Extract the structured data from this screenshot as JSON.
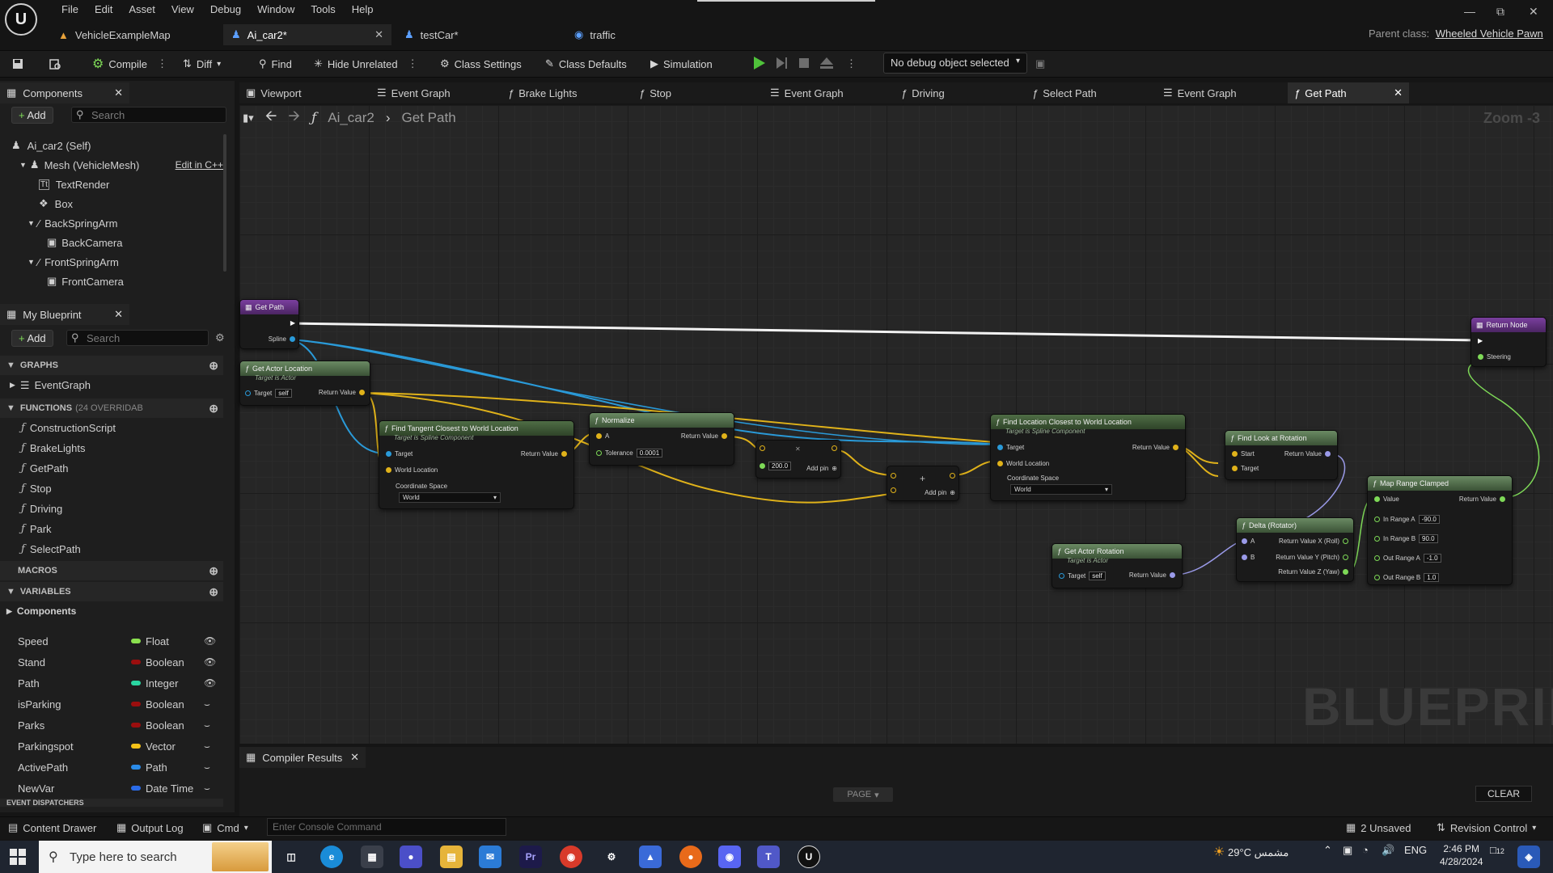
{
  "menu": [
    "File",
    "Edit",
    "Asset",
    "View",
    "Debug",
    "Window",
    "Tools",
    "Help"
  ],
  "doc_tabs": [
    {
      "label": "VehicleExampleMap",
      "icon": "map-icon",
      "active": false
    },
    {
      "label": "Ai_car2*",
      "icon": "pawn-icon",
      "active": true
    },
    {
      "label": "testCar*",
      "icon": "pawn-icon",
      "active": false
    },
    {
      "label": "traffic",
      "icon": "actor-icon",
      "active": false
    }
  ],
  "parent_class": {
    "label": "Parent class:",
    "value": "Wheeled Vehicle Pawn"
  },
  "toolbar": {
    "compile": "Compile",
    "diff": "Diff",
    "find": "Find",
    "hide_unrelated": "Hide Unrelated",
    "class_settings": "Class Settings",
    "class_defaults": "Class Defaults",
    "simulation": "Simulation",
    "debug_object": "No debug object selected"
  },
  "components": {
    "title": "Components",
    "add": "Add",
    "search_placeholder": "Search",
    "tree": [
      {
        "label": "Ai_car2 (Self)",
        "indent": 0
      },
      {
        "label": "Mesh (VehicleMesh)",
        "indent": 1,
        "extra": "Edit in C++"
      },
      {
        "label": "TextRender",
        "indent": 2
      },
      {
        "label": "Box",
        "indent": 2
      },
      {
        "label": "BackSpringArm",
        "indent": 2
      },
      {
        "label": "BackCamera",
        "indent": 3
      },
      {
        "label": "FrontSpringArm",
        "indent": 2
      },
      {
        "label": "FrontCamera",
        "indent": 3
      }
    ]
  },
  "my_blueprint": {
    "title": "My Blueprint",
    "add": "Add",
    "search_placeholder": "Search",
    "graphs_label": "GRAPHS",
    "graphs": [
      "EventGraph"
    ],
    "functions_label": "FUNCTIONS",
    "functions_note": "(24 OVERRIDAB",
    "functions": [
      "ConstructionScript",
      "BrakeLights",
      "GetPath",
      "Stop",
      "Driving",
      "Park",
      "SelectPath"
    ],
    "macros_label": "MACROS",
    "variables_label": "VARIABLES",
    "components_label": "Components",
    "variables": [
      {
        "name": "Speed",
        "type": "Float",
        "color": "#8be04f"
      },
      {
        "name": "Stand",
        "type": "Boolean",
        "color": "#9b0e0e"
      },
      {
        "name": "Path",
        "type": "Integer",
        "color": "#2ad6a1"
      },
      {
        "name": "isParking",
        "type": "Boolean",
        "color": "#9b0e0e"
      },
      {
        "name": "Parks",
        "type": "Boolean",
        "color": "#9b0e0e"
      },
      {
        "name": "Parkingspot",
        "type": "Vector",
        "color": "#f5c218"
      },
      {
        "name": "ActivePath",
        "type": "Path",
        "color": "#2a8be8"
      },
      {
        "name": "NewVar",
        "type": "Date Time",
        "color": "#2a6be8"
      }
    ],
    "event_dispatchers_label": "EVENT DISPATCHERS"
  },
  "graph_tabs": [
    {
      "label": "Viewport",
      "icon": "viewport-icon"
    },
    {
      "label": "Event Graph",
      "icon": "graph-icon"
    },
    {
      "label": "Brake Lights",
      "icon": "function-icon"
    },
    {
      "label": "Stop",
      "icon": "function-icon"
    },
    {
      "label": "Event Graph",
      "icon": "graph-icon"
    },
    {
      "label": "Driving",
      "icon": "function-icon"
    },
    {
      "label": "Select Path",
      "icon": "function-icon"
    },
    {
      "label": "Event Graph",
      "icon": "graph-icon"
    },
    {
      "label": "Get Path",
      "icon": "function-icon",
      "active": true
    }
  ],
  "breadcrumb": {
    "blueprint": "Ai_car2",
    "function": "Get Path"
  },
  "zoom": "Zoom -3",
  "watermark": "BLUEPRINT",
  "nodes": {
    "get_path": {
      "title": "Get Path",
      "spline": "Spline"
    },
    "get_actor_location": {
      "title": "Get Actor Location",
      "subtitle": "Target is Actor",
      "target": "Target",
      "self": "self",
      "ret": "Return Value"
    },
    "find_tangent": {
      "title": "Find Tangent Closest to World Location",
      "subtitle": "Target is Spline Component",
      "target": "Target",
      "world_location": "World Location",
      "coord": "Coordinate Space",
      "world": "World",
      "ret": "Return Value"
    },
    "normalize": {
      "title": "Normalize",
      "a": "A",
      "tolerance": "Tolerance",
      "tol_val": "0.0001",
      "ret": "Return Value"
    },
    "multiply": {
      "value": "200.0",
      "add_pin": "Add pin"
    },
    "add": {
      "add_pin": "Add pin"
    },
    "find_location": {
      "title": "Find Location Closest to World Location",
      "subtitle": "Target is Spline Component",
      "target": "Target",
      "world_location": "World Location",
      "coord": "Coordinate Space",
      "world": "World",
      "ret": "Return Value"
    },
    "find_look": {
      "title": "Find Look at Rotation",
      "start": "Start",
      "target": "Target",
      "ret": "Return Value"
    },
    "get_actor_rotation": {
      "title": "Get Actor Rotation",
      "subtitle": "Target is Actor",
      "target": "Target",
      "self": "self",
      "ret": "Return Value"
    },
    "delta": {
      "title": "Delta (Rotator)",
      "a": "A",
      "b": "B",
      "rx": "Return Value X (Roll)",
      "ry": "Return Value Y (Pitch)",
      "rz": "Return Value Z (Yaw)"
    },
    "map_range": {
      "title": "Map Range Clamped",
      "value": "Value",
      "ret": "Return Value",
      "ira": "In Range A",
      "ira_v": "-90.0",
      "irb": "In Range B",
      "irb_v": "90.0",
      "ora": "Out Range A",
      "ora_v": "-1.0",
      "orb": "Out Range B",
      "orb_v": "1.0"
    },
    "return_node": {
      "title": "Return Node",
      "steering": "Steering"
    }
  },
  "compiler": {
    "tab": "Compiler Results",
    "page": "PAGE",
    "clear": "CLEAR"
  },
  "statusbar": {
    "content_drawer": "Content Drawer",
    "output_log": "Output Log",
    "cmd": "Cmd",
    "console_placeholder": "Enter Console Command",
    "unsaved": "2 Unsaved",
    "revision": "Revision Control"
  },
  "taskbar": {
    "search_placeholder": "Type here to search",
    "weather": "29°C",
    "weather_text": "مشمس",
    "lang": "ENG",
    "time": "2:46 PM",
    "date": "4/28/2024",
    "notif": "12"
  }
}
